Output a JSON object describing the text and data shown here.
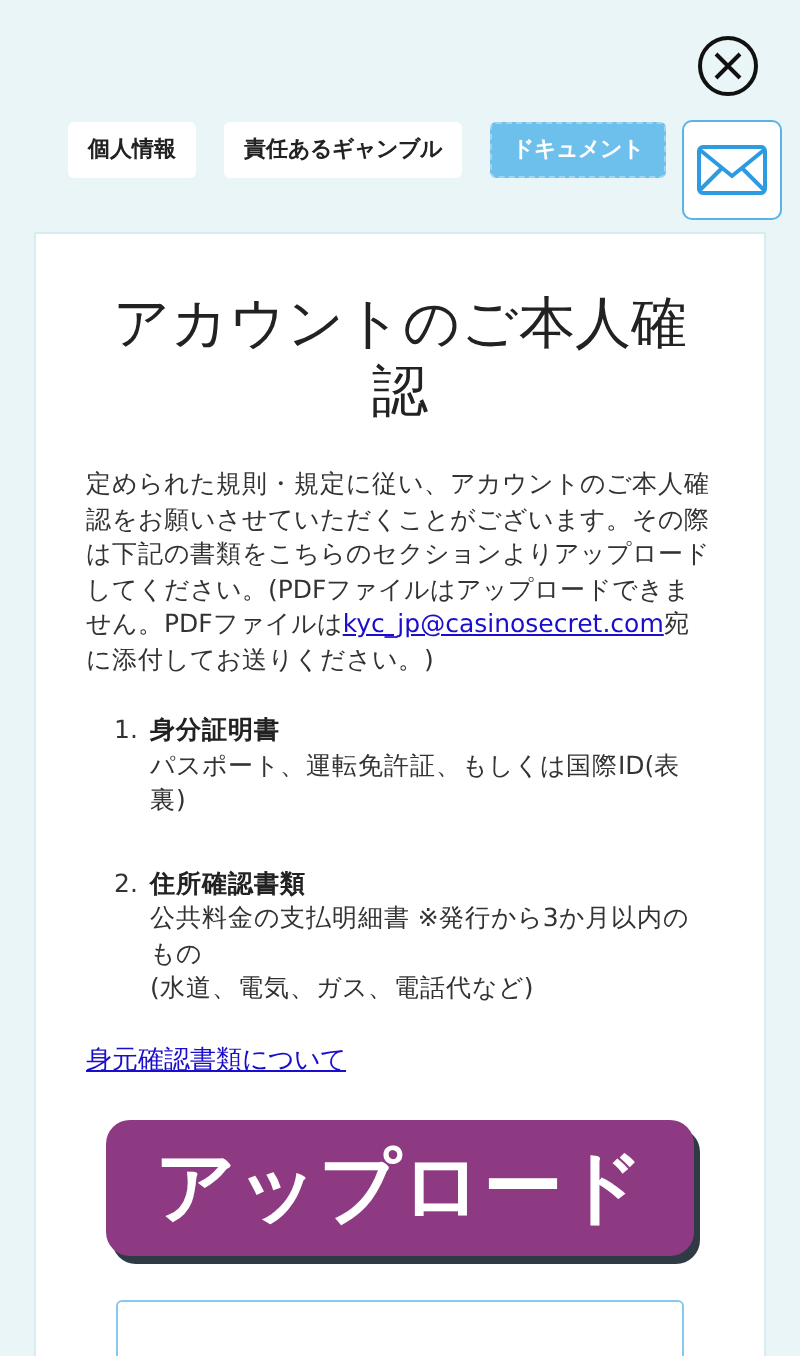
{
  "tabs": [
    {
      "label": "個人情報",
      "selected": false
    },
    {
      "label": "責任あるギャンブル",
      "selected": false
    },
    {
      "label": "ドキュメント",
      "selected": true
    }
  ],
  "title": "アカウントのご本人確認",
  "intro": {
    "before": "定められた規則・規定に従い、アカウントのご本人確認をお願いさせていただくことがございます。その際は下記の書類をこちらのセクションよりアップロードしてください。(PDFファイルはアップロードできません。PDFファイルは",
    "link": "kyc_jp@casinosecret.com",
    "after": "宛に添付してお送りください。)"
  },
  "documents": [
    {
      "number": "1.",
      "name": "身分証明書",
      "lines": [
        "パスポート、運転免許証、もしくは国際ID(表裏)"
      ]
    },
    {
      "number": "2.",
      "name": "住所確認書類",
      "lines": [
        "公共料金の支払明細書 ※発行から3か月以内のもの",
        "(水道、電気、ガス、電話代など)"
      ]
    }
  ],
  "about_link": "身元確認書類について",
  "upload_button": "アップロード"
}
